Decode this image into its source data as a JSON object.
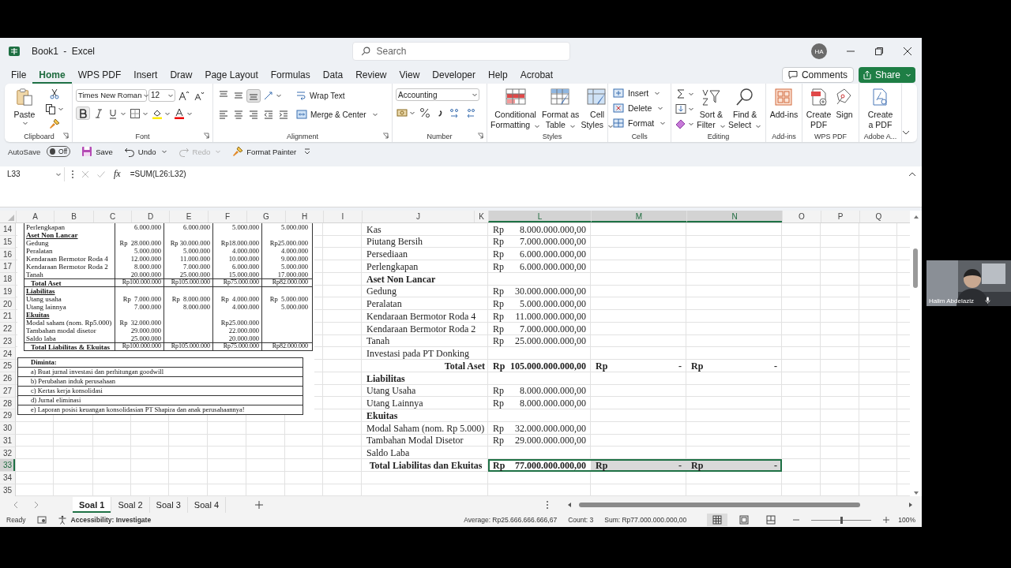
{
  "window": {
    "title": "Book1 - Excel",
    "search": {
      "placeholder": "Search"
    },
    "account": {
      "initials": "HA"
    }
  },
  "tabs": [
    {
      "label": "File",
      "selected": false
    },
    {
      "label": "Home",
      "selected": true
    },
    {
      "label": "WPS PDF",
      "selected": false
    },
    {
      "label": "Insert",
      "selected": false
    },
    {
      "label": "Draw",
      "selected": false
    },
    {
      "label": "Page Layout",
      "selected": false
    },
    {
      "label": "Formulas",
      "selected": false
    },
    {
      "label": "Data",
      "selected": false
    },
    {
      "label": "Review",
      "selected": false
    },
    {
      "label": "View",
      "selected": false
    },
    {
      "label": "Developer",
      "selected": false
    },
    {
      "label": "Help",
      "selected": false
    },
    {
      "label": "Acrobat",
      "selected": false
    }
  ],
  "actions": {
    "comments": "Comments",
    "share": "Share"
  },
  "ribbon": {
    "clipboard": {
      "label": "Clipboard",
      "paste": "Paste"
    },
    "font": {
      "label": "Font",
      "family": "Times New Roman",
      "size": "12"
    },
    "alignment": {
      "label": "Alignment",
      "vertical": [
        {
          "kind": "top",
          "selected": false
        },
        {
          "kind": "middle",
          "selected": false
        },
        {
          "kind": "bottom",
          "selected": true
        }
      ],
      "wrap_text": "Wrap Text",
      "merge": "Merge & Center"
    },
    "number": {
      "label": "Number",
      "format": "Accounting"
    },
    "styles": {
      "label": "Styles",
      "buttons": [
        {
          "kind": "conditional",
          "lines": [
            "Conditional",
            "Formatting"
          ]
        },
        {
          "kind": "table",
          "lines": [
            "Format as",
            "Table"
          ]
        },
        {
          "kind": "cell",
          "lines": [
            "Cell",
            "Styles"
          ]
        }
      ]
    },
    "cells": {
      "label": "Cells",
      "buttons": [
        {
          "kind": "insert",
          "label": "Insert"
        },
        {
          "kind": "delete",
          "label": "Delete"
        },
        {
          "kind": "format",
          "label": "Format"
        }
      ]
    },
    "editing": {
      "label": "Editing",
      "buttons": [
        {
          "kind": "sort",
          "lines": [
            "Sort &",
            "Filter"
          ]
        },
        {
          "kind": "find",
          "lines": [
            "Find &",
            "Select"
          ]
        }
      ]
    },
    "addins": {
      "label": "Add-ins",
      "button": "Add-ins"
    },
    "wps_pdf": {
      "label": "WPS PDF",
      "buttons": [
        {
          "kind": "create",
          "lines": [
            "Create",
            "PDF"
          ]
        },
        {
          "kind": "sign",
          "lines": [
            "Sign"
          ]
        }
      ]
    },
    "adobe": {
      "label": "Adobe A...",
      "button": [
        "Create",
        "a PDF"
      ]
    }
  },
  "quick_access": {
    "autosave": {
      "label": "AutoSave",
      "on": false,
      "state_text": "Off"
    },
    "save": "Save",
    "undo": "Undo",
    "redo": {
      "label": "Redo",
      "disabled": true
    },
    "format_painter": "Format Painter"
  },
  "formula_bar": {
    "name_box": "L33",
    "function_label": "fx",
    "formula": "=SUM(L26:L32)"
  },
  "sheet": {
    "columns": [
      {
        "label": "A",
        "selected": false
      },
      {
        "label": "B",
        "selected": false
      },
      {
        "label": "C",
        "selected": false
      },
      {
        "label": "D",
        "selected": false
      },
      {
        "label": "E",
        "selected": false
      },
      {
        "label": "F",
        "selected": false
      },
      {
        "label": "G",
        "selected": false
      },
      {
        "label": "H",
        "selected": false
      },
      {
        "label": "I",
        "selected": false
      },
      {
        "label": "J",
        "selected": false
      },
      {
        "label": "K",
        "selected": false
      },
      {
        "label": "L",
        "selected": true
      },
      {
        "label": "M",
        "selected": true
      },
      {
        "label": "N",
        "selected": true
      },
      {
        "label": "O",
        "selected": false
      },
      {
        "label": "P",
        "selected": false
      },
      {
        "label": "Q",
        "selected": false
      }
    ],
    "rows": [
      {
        "number": "14",
        "selected": false,
        "kind": "item",
        "label": "Kas",
        "cells": [
          {
            "currency": "Rp",
            "value": "8.000.000.000,00",
            "selected": false
          }
        ]
      },
      {
        "number": "15",
        "selected": false,
        "kind": "item",
        "label": "Piutang Bersih",
        "cells": [
          {
            "currency": "Rp",
            "value": "7.000.000.000,00",
            "selected": false
          }
        ]
      },
      {
        "number": "16",
        "selected": false,
        "kind": "item",
        "label": "Persediaan",
        "cells": [
          {
            "currency": "Rp",
            "value": "6.000.000.000,00",
            "selected": false
          }
        ]
      },
      {
        "number": "17",
        "selected": false,
        "kind": "item",
        "label": "Perlengkapan",
        "cells": [
          {
            "currency": "Rp",
            "value": "6.000.000.000,00",
            "selected": false
          }
        ]
      },
      {
        "number": "18",
        "selected": false,
        "kind": "heading",
        "label": "Aset Non Lancar"
      },
      {
        "number": "19",
        "selected": false,
        "kind": "item",
        "label": "Gedung",
        "cells": [
          {
            "currency": "Rp",
            "value": "30.000.000.000,00",
            "selected": false
          }
        ]
      },
      {
        "number": "20",
        "selected": false,
        "kind": "item",
        "label": "Peralatan",
        "cells": [
          {
            "currency": "Rp",
            "value": "5.000.000.000,00",
            "selected": false
          }
        ]
      },
      {
        "number": "21",
        "selected": false,
        "kind": "item",
        "label": "Kendaraan Bermotor Roda 4",
        "cells": [
          {
            "currency": "Rp",
            "value": "11.000.000.000,00",
            "selected": false
          }
        ]
      },
      {
        "number": "22",
        "selected": false,
        "kind": "item",
        "label": "Kendaraan Bermotor Roda 2",
        "cells": [
          {
            "currency": "Rp",
            "value": "7.000.000.000,00",
            "selected": false
          }
        ]
      },
      {
        "number": "23",
        "selected": false,
        "kind": "item",
        "label": "Tanah",
        "cells": [
          {
            "currency": "Rp",
            "value": "25.000.000.000,00",
            "selected": false
          }
        ]
      },
      {
        "number": "24",
        "selected": false,
        "kind": "item",
        "label": "Investasi pada PT Donking"
      },
      {
        "number": "25",
        "selected": false,
        "kind": "subtotal",
        "label": "Total Aset",
        "cells": [
          {
            "currency": "Rp",
            "value": "105.000.000.000,00",
            "selected": false
          },
          {
            "currency": "Rp",
            "value": "-",
            "selected": false
          },
          {
            "currency": "Rp",
            "value": "-",
            "selected": false
          }
        ]
      },
      {
        "number": "26",
        "selected": false,
        "kind": "heading",
        "label": "Liabilitas"
      },
      {
        "number": "27",
        "selected": false,
        "kind": "item",
        "label": "Utang Usaha",
        "cells": [
          {
            "currency": "Rp",
            "value": "8.000.000.000,00",
            "selected": false
          }
        ]
      },
      {
        "number": "28",
        "selected": false,
        "kind": "item",
        "label": "Utang Lainnya",
        "cells": [
          {
            "currency": "Rp",
            "value": "8.000.000.000,00",
            "selected": false
          }
        ]
      },
      {
        "number": "29",
        "selected": false,
        "kind": "heading",
        "label": "Ekuitas"
      },
      {
        "number": "30",
        "selected": false,
        "kind": "item",
        "label": "Modal Saham (nom. Rp 5.000)",
        "cells": [
          {
            "currency": "Rp",
            "value": "32.000.000.000,00",
            "selected": false
          }
        ]
      },
      {
        "number": "31",
        "selected": false,
        "kind": "item",
        "label": "Tambahan Modal Disetor",
        "cells": [
          {
            "currency": "Rp",
            "value": "29.000.000.000,00",
            "selected": false
          }
        ]
      },
      {
        "number": "32",
        "selected": false,
        "kind": "item",
        "label": "Saldo Laba"
      },
      {
        "number": "33",
        "selected": true,
        "kind": "total",
        "label": "Total Liabilitas dan Ekuitas",
        "cells": [
          {
            "currency": "Rp",
            "value": "77.000.000.000,00",
            "selected": true
          },
          {
            "currency": "Rp",
            "value": "-",
            "selected": true
          },
          {
            "currency": "Rp",
            "value": "-",
            "selected": true
          }
        ]
      },
      {
        "number": "34",
        "selected": false
      },
      {
        "number": "35",
        "selected": false
      }
    ]
  },
  "document_image": {
    "rows": [
      {
        "kind": "item",
        "label": "Perlengkapan",
        "d": "6.000.000",
        "e": "6.000.000",
        "f": "5.000.000",
        "g": "5.000.000"
      },
      {
        "kind": "heading",
        "label": "Aset Non Lancar"
      },
      {
        "kind": "item",
        "label": "Gedung",
        "d": "Rp  28.000.000",
        "e": "Rp 30.000.000",
        "f": "Rp18.000.000",
        "g": "Rp25.000.000"
      },
      {
        "kind": "item",
        "label": "Peralatan",
        "d": "5.000.000",
        "e": "5.000.000",
        "f": "4.000.000",
        "g": "4.000.000"
      },
      {
        "kind": "item",
        "label": "Kendaraan Bermotor Roda 4",
        "d": "12.000.000",
        "e": "11.000.000",
        "f": "10.000.000",
        "g": "9.000.000"
      },
      {
        "kind": "item",
        "label": "Kendaraan Bermotor Roda 2",
        "d": "8.000.000",
        "e": "7.000.000",
        "f": "6.000.000",
        "g": "5.000.000"
      },
      {
        "kind": "item",
        "label": "Tanah",
        "d": "20.000.000",
        "e": "25.000.000",
        "f": "15.000.000",
        "g": "17.000.000"
      },
      {
        "kind": "total",
        "label": "Total Aset",
        "d": "Rp100.000.000",
        "e": "Rp105.000.000",
        "f": "Rp75.000.000",
        "g": "Rp82.000.000"
      },
      {
        "kind": "heading",
        "label": "Liabilitas"
      },
      {
        "kind": "item",
        "label": "Utang usaha",
        "d": "Rp  7.000.000",
        "e": "Rp  8.000.000",
        "f": "Rp  4.000.000",
        "g": "Rp  5.000.000"
      },
      {
        "kind": "item",
        "label": "Utang lainnya",
        "d": "7.000.000",
        "e": "8.000.000",
        "f": "4.000.000",
        "g": "5.000.000"
      },
      {
        "kind": "heading",
        "label": "Ekuitas"
      },
      {
        "kind": "item",
        "label": "Modal saham (nom. Rp5.000)",
        "d": "Rp  32.000.000",
        "f": "Rp25.000.000"
      },
      {
        "kind": "item",
        "label": "Tambahan modal disetor",
        "d": "29.000.000",
        "f": "22.000.000"
      },
      {
        "kind": "item",
        "label": "Saldo laba",
        "d": "25.000.000",
        "f": "20.000.000"
      },
      {
        "kind": "total",
        "label": "Total Liabilitas & Ekuitas",
        "d": "Rp100.000.000",
        "e": "Rp105.000.000",
        "f": "Rp75.000.000",
        "g": "Rp82.000.000"
      }
    ],
    "requests": {
      "title": "Diminta:",
      "items": [
        {
          "marker": "a)",
          "text": "Buat jurnal investasi dan perhitungan goodwill"
        },
        {
          "marker": "b)",
          "text": "Perubahan induk perusahaan"
        },
        {
          "marker": "c)",
          "text": "Kertas kerja konsolidasi"
        },
        {
          "marker": "d)",
          "text": "Jurnal eliminasi"
        },
        {
          "marker": "e)",
          "text": "Laporan posisi keuangan konsolidasian PT Shapira dan anak perusahaannya!"
        }
      ]
    }
  },
  "sheet_tabs": [
    {
      "label": "Soal 1",
      "selected": true
    },
    {
      "label": "Soal 2",
      "selected": false
    },
    {
      "label": "Soal 3",
      "selected": false
    },
    {
      "label": "Soal 4",
      "selected": false
    }
  ],
  "status_bar": {
    "mode": "Ready",
    "accessibility": "Accessibility: Investigate",
    "average": "Average: Rp25.666.666.666,67",
    "count": "Count: 3",
    "sum": "Sum: Rp77.000.000.000,00",
    "views": [
      {
        "kind": "normal",
        "selected": true
      },
      {
        "kind": "page_layout",
        "selected": false
      },
      {
        "kind": "page_break",
        "selected": false
      }
    ],
    "zoom": {
      "level": 0.5,
      "reading": "100%"
    }
  },
  "video": {
    "name": "Halim Abdelaziz"
  }
}
